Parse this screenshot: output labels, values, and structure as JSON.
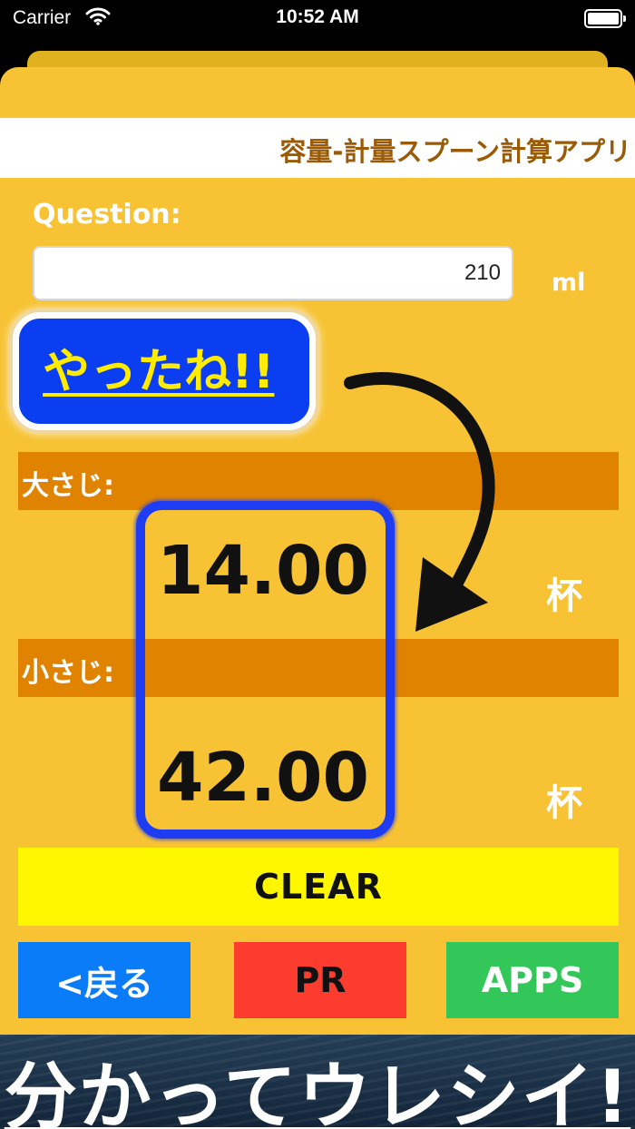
{
  "status_bar": {
    "carrier": "Carrier",
    "time": "10:52 AM"
  },
  "header": {
    "title": "容量-計量スプーン計算アプリ"
  },
  "question": {
    "label": "Question:",
    "value": "210",
    "unit": "ml"
  },
  "badge": {
    "text": "やったね!!"
  },
  "results": [
    {
      "label": "大さじ:",
      "value": "14.00",
      "unit": "杯"
    },
    {
      "label": "小さじ:",
      "value": "42.00",
      "unit": "杯"
    }
  ],
  "buttons": {
    "clear": "CLEAR",
    "back": "<戻る",
    "pr": "PR",
    "apps": "APPS"
  },
  "banner": {
    "text": "分かってウレシイ!"
  },
  "colors": {
    "sheet": "#f7c334",
    "band": "#e08300",
    "accent_blue": "#1e3cf2",
    "title": "#9a5a06"
  }
}
